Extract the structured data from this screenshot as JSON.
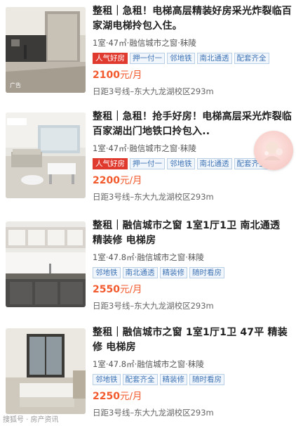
{
  "listings": [
    {
      "title": "整租｜急租！电梯高层精装好房采光炸裂临百家湖电梯拎包入住。",
      "meta": "1室·47㎡·融信城市之窗·秣陵",
      "tags": [
        "人气好房",
        "押一付一",
        "邻地铁",
        "南北通透",
        "配套齐全"
      ],
      "hot_tag": "人气好房",
      "price": "2100",
      "price_unit": "元/月",
      "distance": "日距3号线–东大九龙湖校区293m"
    },
    {
      "title": "整租｜急租！抢手好房！电梯高层采光炸裂临百家湖出门地铁口拎包入..",
      "meta": "1室·47㎡·融信城市之窗·秣陵",
      "tags": [
        "人气好房",
        "押一付一",
        "邻地铁",
        "南北通透",
        "配套齐全"
      ],
      "hot_tag": "人气好房",
      "price": "2200",
      "price_unit": "元/月",
      "distance": "日距3号线–东大九龙湖校区293m"
    },
    {
      "title": "整租｜融信城市之窗 1室1厅1卫 南北通透 精装修 电梯房",
      "meta": "1室·47.8㎡·融信城市之窗·秣陵",
      "tags": [
        "邻地铁",
        "南北通透",
        "精装修",
        "随时看房"
      ],
      "hot_tag": "",
      "price": "2550",
      "price_unit": "元/月",
      "distance": "日距3号线–东大九龙湖校区293m"
    },
    {
      "title": "整租｜融信城市之窗 1室1厅1卫 47平 精装修 电梯房",
      "meta": "1室·47.8㎡·融信城市之窗·秣陵",
      "tags": [
        "邻地铁",
        "配套齐全",
        "精装修",
        "随时看房"
      ],
      "hot_tag": "",
      "price": "2250",
      "price_unit": "元/月",
      "distance": "日距3号线–东大九龙湖校区293m"
    }
  ],
  "thumb_caption": "广告",
  "watermark": "搜狐号 · 房产资讯",
  "colors": {
    "price": "#f25a2d",
    "tag_text": "#3f74b5",
    "tag_border": "#b9cfe6",
    "hot_tag_bg": "#e03a2f"
  }
}
